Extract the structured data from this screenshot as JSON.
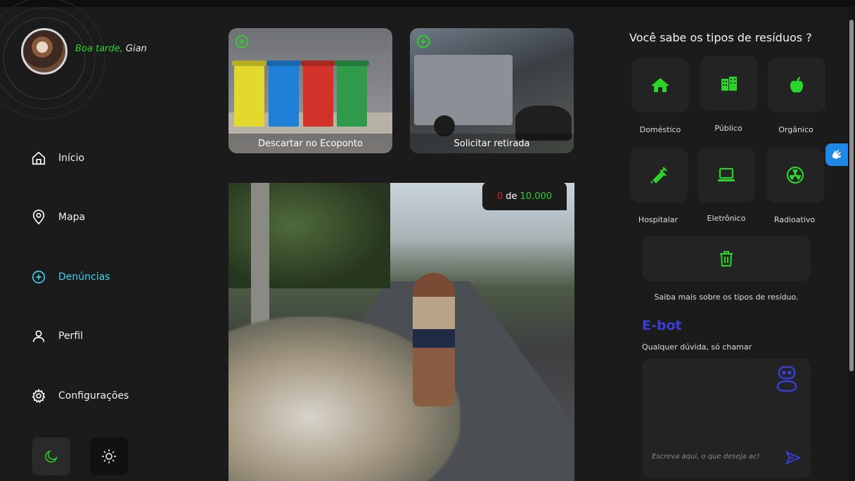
{
  "user": {
    "greeting": "Boa tarde,",
    "name": "Gian"
  },
  "sidebar": {
    "items": [
      {
        "label": "Início",
        "icon": "home-icon"
      },
      {
        "label": "Mapa",
        "icon": "map-pin-icon"
      },
      {
        "label": "Denúncias",
        "icon": "plus-circle-icon",
        "active": true
      },
      {
        "label": "Perfil",
        "icon": "user-icon"
      },
      {
        "label": "Configurações",
        "icon": "gear-icon"
      }
    ],
    "theme": {
      "dark_icon": "moon-icon",
      "light_icon": "sun-icon"
    }
  },
  "actions": {
    "ecoponto": "Descartar no Ecoponto",
    "retirada": "Solicitar retirada"
  },
  "counter": {
    "current": "0",
    "separator": "de",
    "max": "10.000"
  },
  "waste": {
    "title": "Você sabe os tipos de resíduos ?",
    "types": [
      {
        "label": "Doméstico",
        "icon": "house-icon"
      },
      {
        "label": "Público",
        "icon": "buildings-icon"
      },
      {
        "label": "Orgânico",
        "icon": "apple-icon"
      },
      {
        "label": "Hospitalar",
        "icon": "syringe-icon"
      },
      {
        "label": "Eletrônico",
        "icon": "laptop-icon"
      },
      {
        "label": "Radioativo",
        "icon": "radioactive-icon"
      }
    ],
    "more": "Saiba mais sobre os tipos de resíduo."
  },
  "ebot": {
    "title": "E-bot",
    "subtitle": "Qualquer dúvida, só chamar",
    "placeholder": "Escreva aqui, o que deseja ac!"
  },
  "colors": {
    "accent_green": "#2bd42b",
    "accent_cyan": "#3fd3ea",
    "ebot_blue": "#3a3dd6",
    "counter_red": "#e0242a"
  }
}
